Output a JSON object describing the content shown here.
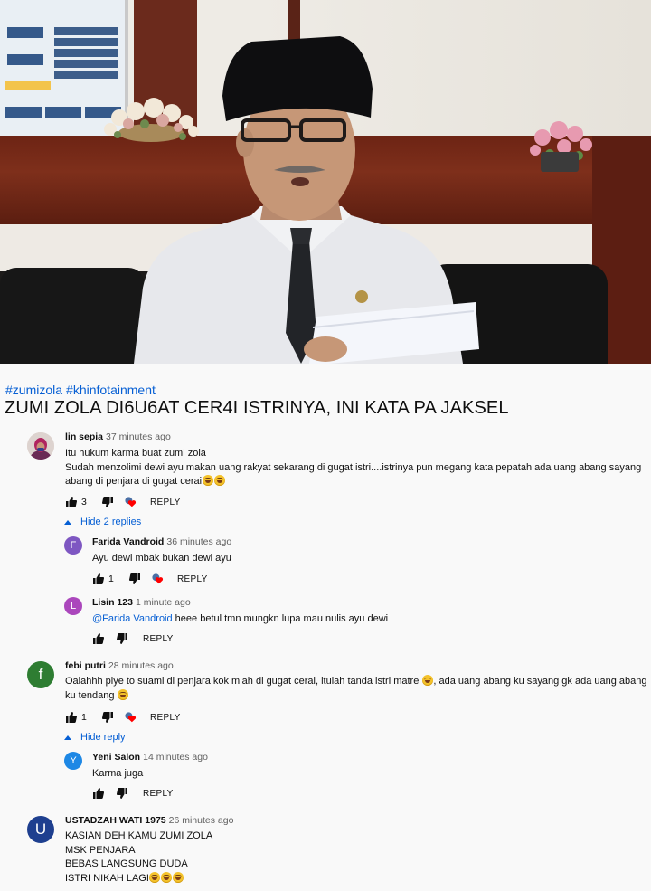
{
  "video": {
    "hashtags": [
      "#zumizola",
      "#khinfotainment"
    ],
    "title": "ZUMI ZOLA DI6U6AT CER4I ISTRINYA, INI KATA PA JAKSEL"
  },
  "reply_label": "REPLY",
  "colors": {
    "link": "#065fd4",
    "avatar_F": "#7e57c2",
    "avatar_L": "#ab47bc",
    "avatar_f": "#2e7d32",
    "avatar_Y": "#1e88e5",
    "avatar_U": "#1e3f8f"
  },
  "comments": [
    {
      "author": "lin sepia",
      "time": "37 minutes ago",
      "lines": [
        "Itu hukum karma buat zumi zola",
        "Sudah menzolimi dewi ayu makan uang rakyat sekarang di gugat istri....istrinya pun megang kata pepatah ada uang abang sayang",
        "abang di penjara di gugat cerai"
      ],
      "likes": "3",
      "toggle": "Hide 2 replies",
      "replies": [
        {
          "initial": "F",
          "author": "Farida Vandroid",
          "time": "36 minutes ago",
          "text": "Ayu dewi mbak bukan dewi ayu",
          "likes": "1"
        },
        {
          "initial": "L",
          "author": "Lisin 123",
          "time": "1 minute ago",
          "mention": "@Farida Vandroid",
          "text": " heee betul tmn mungkn lupa mau nulis ayu dewi",
          "likes": ""
        }
      ]
    },
    {
      "initial": "f",
      "author": "febi putri",
      "time": "28 minutes ago",
      "lines": [
        "Oalahhh piye to suami di penjara  kok mlah di gugat cerai, itulah tanda istri matre",
        ", ada uang abang ku sayang gk ada uang abang",
        "ku tendang"
      ],
      "likes": "1",
      "toggle": "Hide reply",
      "replies": [
        {
          "initial": "Y",
          "author": "Yeni Salon",
          "time": "14 minutes ago",
          "text": "Karma  juga",
          "likes": ""
        }
      ]
    },
    {
      "initial": "U",
      "author": "USTADZAH WATI 1975",
      "time": "26 minutes ago",
      "lines": [
        "KASIAN DEH KAMU ZUMI ZOLA",
        "MSK PENJARA",
        "BEBAS LANGSUNG DUDA",
        "ISTRI NIKAH LAGI"
      ]
    }
  ]
}
